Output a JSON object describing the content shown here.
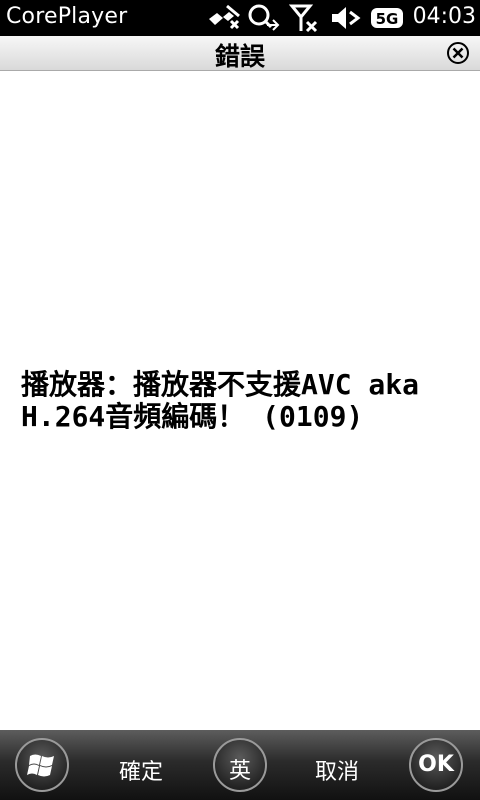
{
  "status_bar": {
    "app_name": "CorePlayer",
    "time": "04:03",
    "network_badge": "5G"
  },
  "dialog": {
    "title": "錯誤"
  },
  "message": {
    "line1": "播放器：播放器不支援AVC aka",
    "line2": "H.264音頻編碼！ (0109)"
  },
  "softkeys": {
    "left": "確定",
    "ime": "英",
    "right": "取消",
    "ok": "OK"
  }
}
